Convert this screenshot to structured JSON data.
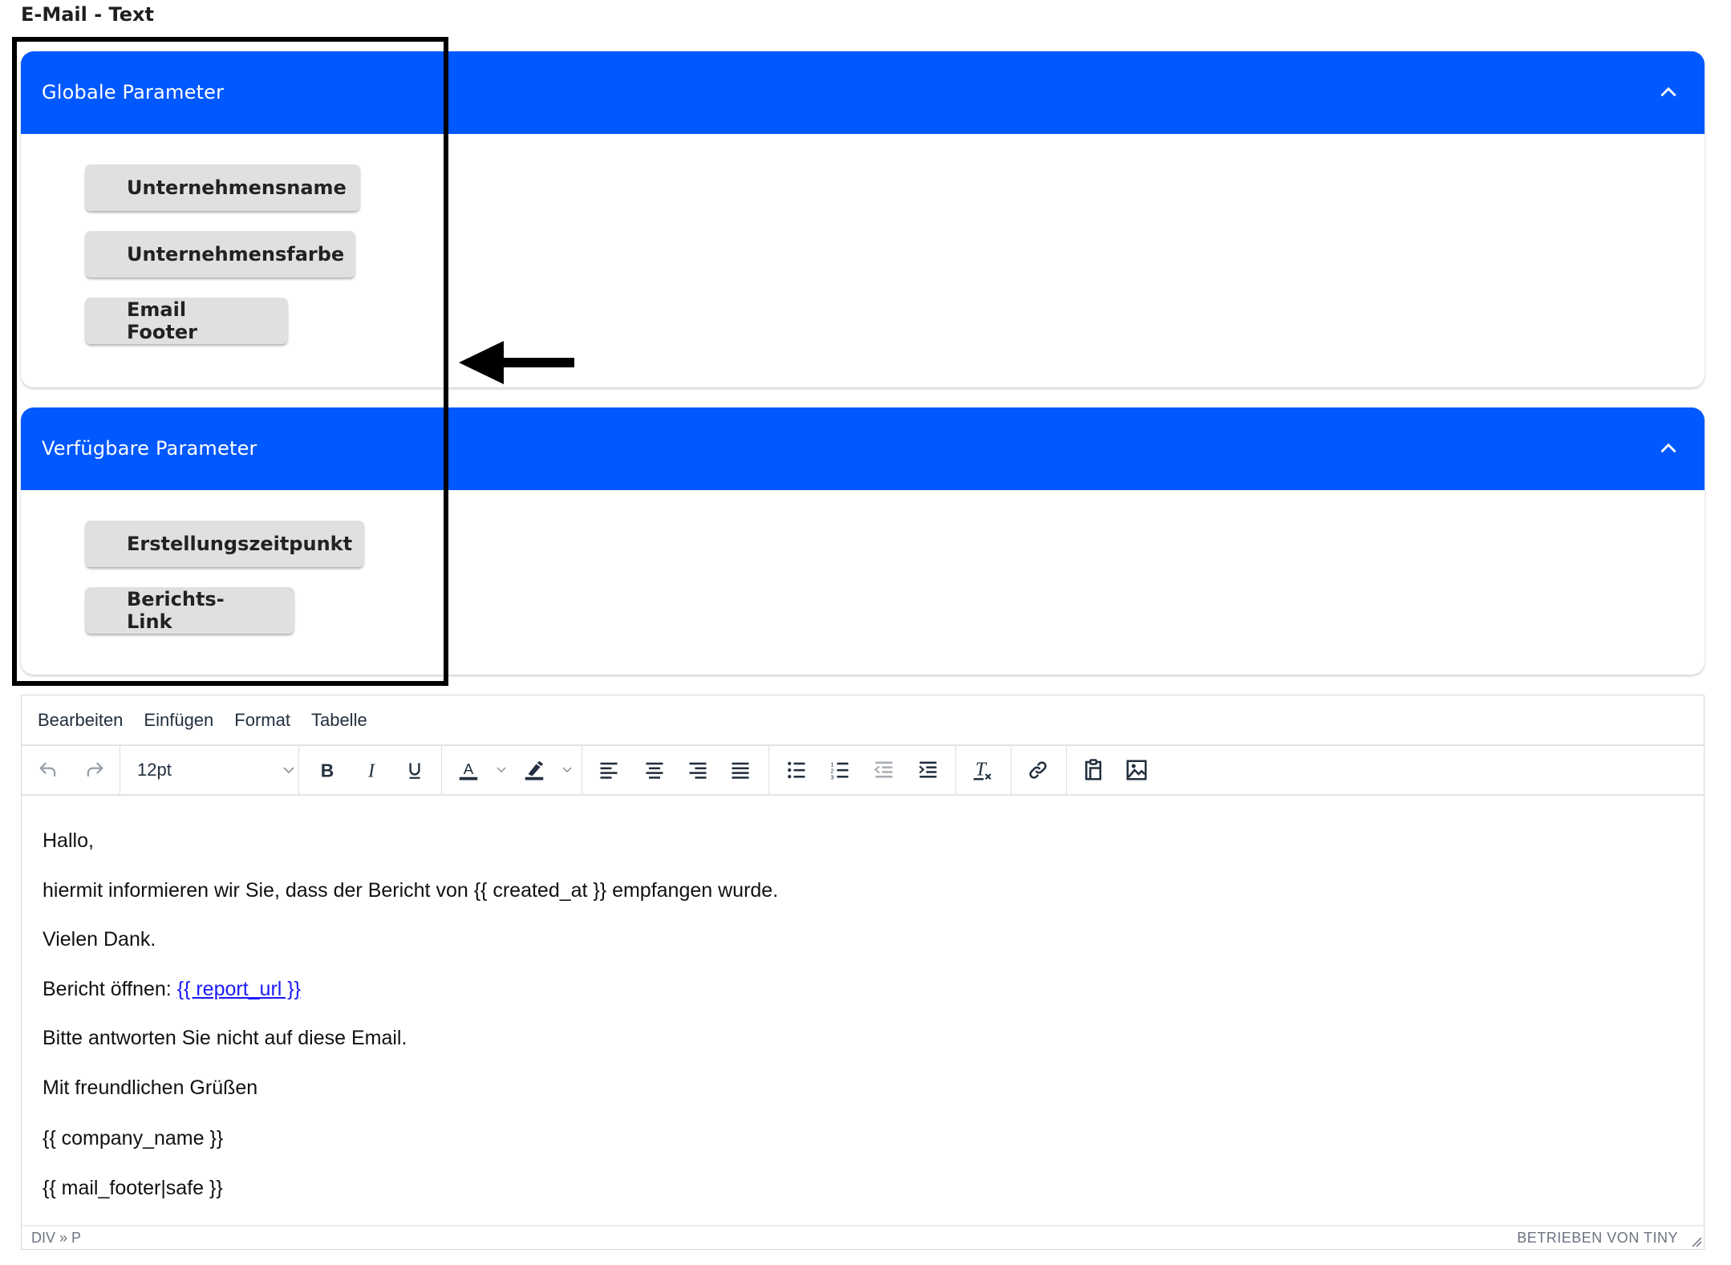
{
  "page": {
    "title": "E-Mail - Text"
  },
  "panels": [
    {
      "title": "Globale Parameter",
      "expanded": true,
      "toggle_icon": "chevron-up-icon",
      "buttons": [
        {
          "label": "Unternehmensname"
        },
        {
          "label": "Unternehmensfarbe"
        },
        {
          "label": "Email Footer"
        }
      ]
    },
    {
      "title": "Verfügbare Parameter",
      "expanded": true,
      "toggle_icon": "chevron-up-icon",
      "buttons": [
        {
          "label": "Erstellungszeitpunkt"
        },
        {
          "label": "Berichts-Link"
        }
      ]
    }
  ],
  "annotation": {
    "highlight_box": "black rectangle around parameter buttons",
    "arrow_direction": "left"
  },
  "editor": {
    "menubar": [
      "Bearbeiten",
      "Einfügen",
      "Format",
      "Tabelle"
    ],
    "toolbar": {
      "undo": {
        "icon": "undo-icon",
        "enabled": false
      },
      "redo": {
        "icon": "redo-icon",
        "enabled": false
      },
      "font_size": "12pt",
      "buttons": [
        {
          "icon": "bold-icon"
        },
        {
          "icon": "italic-icon"
        },
        {
          "icon": "underline-icon"
        },
        {
          "icon": "text-color-icon"
        },
        {
          "icon": "highlight-color-icon"
        },
        {
          "icon": "align-left-icon"
        },
        {
          "icon": "align-center-icon"
        },
        {
          "icon": "align-right-icon"
        },
        {
          "icon": "align-justify-icon"
        },
        {
          "icon": "bullet-list-icon"
        },
        {
          "icon": "numbered-list-icon"
        },
        {
          "icon": "outdent-icon",
          "enabled": false
        },
        {
          "icon": "indent-icon"
        },
        {
          "icon": "clear-formatting-icon"
        },
        {
          "icon": "link-icon"
        },
        {
          "icon": "paste-icon"
        },
        {
          "icon": "image-icon"
        }
      ]
    },
    "content": {
      "lines": [
        {
          "text": "Hallo,"
        },
        {
          "text": "hiermit informieren wir Sie, dass der Bericht von {{ created_at }} empfangen wurde."
        },
        {
          "text": "Vielen Dank."
        },
        {
          "text": "Bericht öffnen: ",
          "link": "{{ report_url }}"
        },
        {
          "text": "Bitte antworten Sie nicht auf diese Email."
        },
        {
          "text": "Mit freundlichen Grüßen"
        },
        {
          "text": "{{ company_name }}"
        },
        {
          "text": "{{ mail_footer|safe }}"
        }
      ]
    },
    "statusbar": {
      "path": "DIV » P",
      "brand": "BETRIEBEN VON TINY"
    }
  },
  "colors": {
    "accent": "#0058ff",
    "button_bg": "#e0e0e0",
    "link": "#1a1aff"
  }
}
